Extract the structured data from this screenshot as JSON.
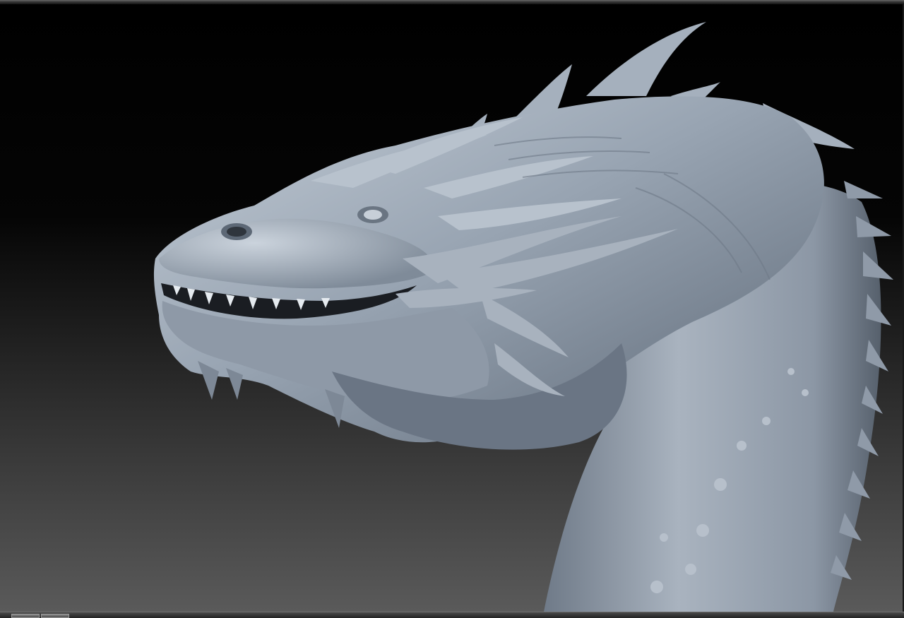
{
  "viewport": {
    "subject": "dragon-head-sculpt",
    "background_top": "#000000",
    "background_bottom": "#5a5a5a",
    "material_color": "#9aa6b4"
  },
  "icons": [
    "document-button",
    "canvas-button"
  ]
}
